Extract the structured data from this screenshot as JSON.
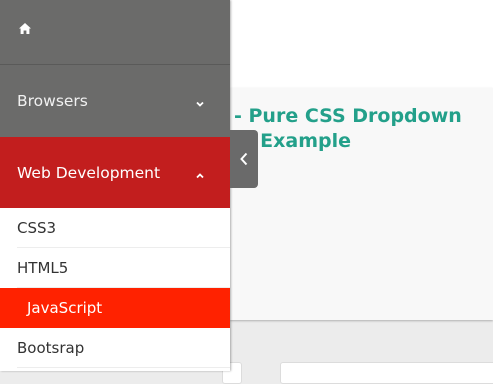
{
  "sidebar": {
    "home_icon": "home-icon",
    "items": [
      {
        "label": "Browsers",
        "icon": "chevron-down-icon"
      },
      {
        "label": "Web Development",
        "icon": "chevron-up-icon"
      }
    ],
    "submenu": [
      {
        "label": "CSS3"
      },
      {
        "label": "HTML5"
      },
      {
        "label": "JavaScript",
        "active": true
      },
      {
        "label": "Bootsrap"
      }
    ]
  },
  "toggle": {
    "icon": "chevron-left-icon"
  },
  "main": {
    "title_line1": "- Pure CSS Dropdown",
    "title_line2": "n Example"
  },
  "colors": {
    "sidebar_bg": "#6b6b6a",
    "active_section": "#c21e1e",
    "active_item": "#ff2200",
    "title_accent": "#23a08a"
  }
}
